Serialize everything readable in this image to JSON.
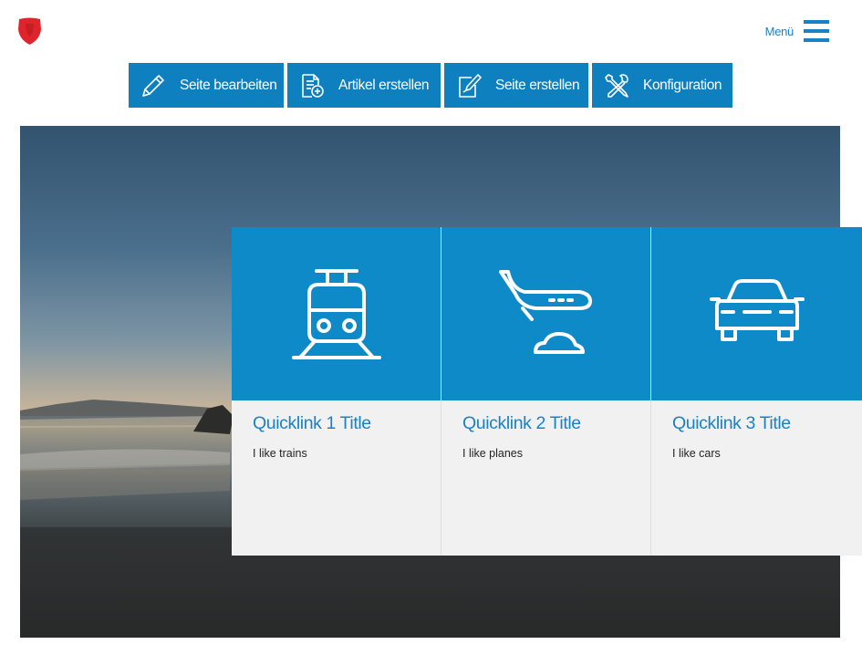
{
  "header": {
    "logo_icon": "shield-icon",
    "menu_label": "Menü",
    "menu_icon": "hamburger-icon",
    "accent_color": "#1a82c4"
  },
  "toolbar": {
    "background_color": "#0e7fbf",
    "buttons": [
      {
        "label": "Seite bearbeiten",
        "icon": "pencil-icon"
      },
      {
        "label": "Artikel erstellen",
        "icon": "add-document-icon"
      },
      {
        "label": "Seite erstellen",
        "icon": "edit-page-icon"
      },
      {
        "label": "Konfiguration",
        "icon": "tools-icon"
      }
    ]
  },
  "hero": {
    "image": "beach-sunset-photo"
  },
  "quicklinks": {
    "tile_color": "#0e8ac9",
    "items": [
      {
        "title": "Quicklink 1 Title",
        "text": "I like trains",
        "icon": "train-icon"
      },
      {
        "title": "Quicklink 2 Title",
        "text": "I like planes",
        "icon": "plane-icon"
      },
      {
        "title": "Quicklink 3 Title",
        "text": "I like cars",
        "icon": "car-icon"
      }
    ]
  }
}
